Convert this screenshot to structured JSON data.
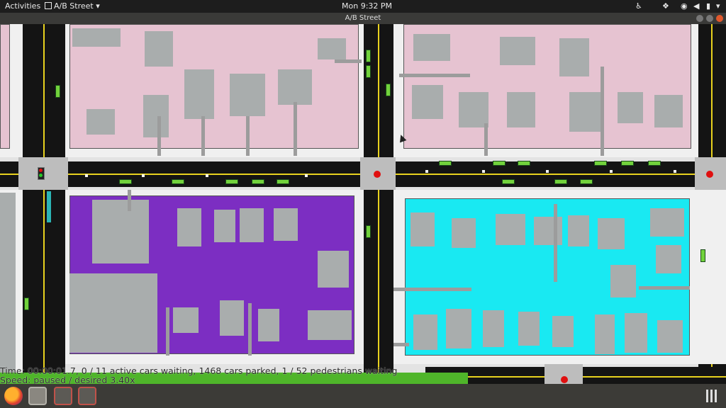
{
  "system_bar": {
    "activities": "Activities",
    "app_menu": "A/B Street",
    "clock": "Mon  9:32 PM"
  },
  "window": {
    "title": "A/B Street"
  },
  "status": {
    "line1": "Time: 00:00:01.7, 0 / 11 active cars waiting, 1468 cars parked, 1 / 52 pedestrians waiting",
    "line2": "Speed: paused / desired 3.40x"
  },
  "colors": {
    "residential_zone": "#e6c3d1",
    "selected_zone_a": "#7c2ec2",
    "selected_zone_b": "#19e9f2",
    "road": "#141414",
    "lane_marking": "#e8d21e",
    "parked_car": "#72d23c",
    "signal_red": "#e01010"
  },
  "dock": {
    "apps": [
      "firefox-icon",
      "files-icon",
      "abstreet-window-icon-1",
      "abstreet-window-icon-2"
    ]
  }
}
